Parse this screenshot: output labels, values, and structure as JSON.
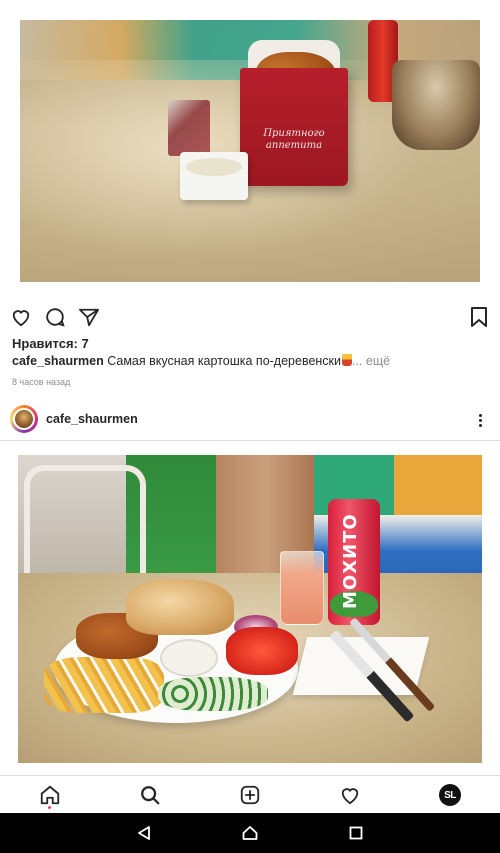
{
  "post1": {
    "image_alt": "potato wedges in red box with sauce cup",
    "box_text": "Приятного аппетита",
    "likes": "Нравится: 7",
    "username": "cafe_shaurmen",
    "caption": "Самая вкусная картошка по-деревенски",
    "more": "... ещё",
    "time": "8 часов назад"
  },
  "post2": {
    "username": "cafe_shaurmen",
    "image_alt": "shawarma plate with fries, vegetables and Mojito can",
    "can_text": "МОХИТО"
  },
  "icons": {
    "like": "heart-icon",
    "comment": "comment-icon",
    "share": "send-icon",
    "save": "bookmark-icon",
    "more": "more-vertical-icon"
  },
  "bottom_nav": {
    "items": [
      "home-icon",
      "search-icon",
      "add-post-icon",
      "activity-heart-icon",
      "profile-avatar"
    ],
    "profile_initials": "SL"
  },
  "system_nav": [
    "back-icon",
    "home-icon",
    "recents-icon"
  ],
  "colors": {
    "text": "#262626",
    "secondary": "#8e8e8e",
    "notification_dot": "#ed4956",
    "system_bar": "#000000"
  }
}
